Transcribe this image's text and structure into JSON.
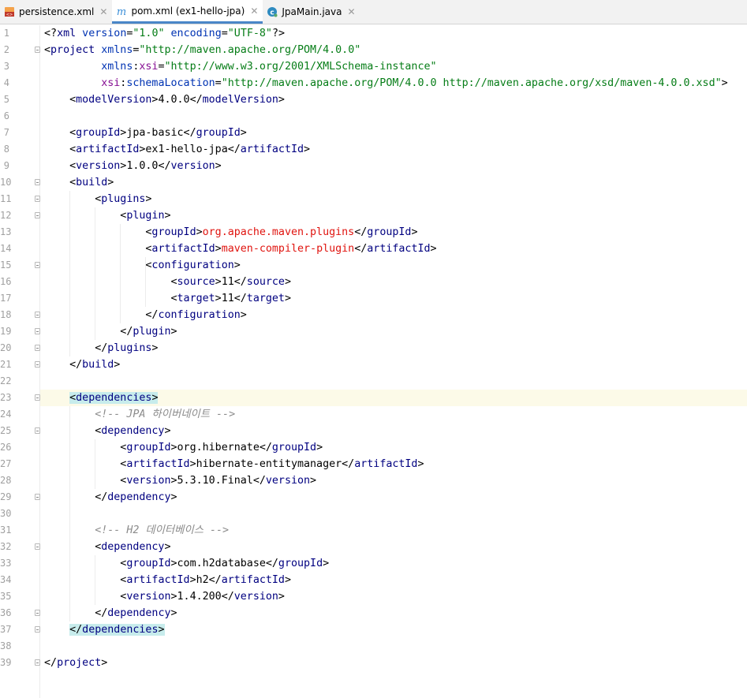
{
  "tabs": [
    {
      "label": "persistence.xml",
      "icon": "xml-file-icon",
      "active": false
    },
    {
      "label": "pom.xml (ex1-hello-jpa)",
      "icon": "maven-icon",
      "active": true
    },
    {
      "label": "JpaMain.java",
      "icon": "java-class-icon",
      "active": false
    }
  ],
  "editor": {
    "caret_line": 23,
    "lines": [
      [
        [
          "p",
          "<?"
        ],
        [
          "k",
          "xml "
        ],
        [
          "a",
          "version"
        ],
        [
          "p",
          "="
        ],
        [
          "s",
          "\"1.0\" "
        ],
        [
          "a",
          "encoding"
        ],
        [
          "p",
          "="
        ],
        [
          "s",
          "\"UTF-8\""
        ],
        [
          "p",
          "?>"
        ]
      ],
      [
        [
          "p",
          "<"
        ],
        [
          "k",
          "project "
        ],
        [
          "a",
          "xmlns"
        ],
        [
          "p",
          "="
        ],
        [
          "s",
          "\"http://maven.apache.org/POM/4.0.0\""
        ]
      ],
      [
        [
          "p",
          "         "
        ],
        [
          "a",
          "xmlns"
        ],
        [
          "p",
          ":"
        ],
        [
          "ns",
          "xsi"
        ],
        [
          "p",
          "="
        ],
        [
          "s",
          "\"http://www.w3.org/2001/XMLSchema-instance\""
        ]
      ],
      [
        [
          "p",
          "         "
        ],
        [
          "ns",
          "xsi"
        ],
        [
          "p",
          ":"
        ],
        [
          "a",
          "schemaLocation"
        ],
        [
          "p",
          "="
        ],
        [
          "s",
          "\"http://maven.apache.org/POM/4.0.0 http://maven.apache.org/xsd/maven-4.0.0.xsd\""
        ],
        [
          "p",
          ">"
        ]
      ],
      [
        [
          "p",
          "    <"
        ],
        [
          "k",
          "modelVersion"
        ],
        [
          "p",
          ">4.0.0</"
        ],
        [
          "k",
          "modelVersion"
        ],
        [
          "p",
          ">"
        ]
      ],
      [],
      [
        [
          "p",
          "    <"
        ],
        [
          "k",
          "groupId"
        ],
        [
          "p",
          ">jpa-basic</"
        ],
        [
          "k",
          "groupId"
        ],
        [
          "p",
          ">"
        ]
      ],
      [
        [
          "p",
          "    <"
        ],
        [
          "k",
          "artifactId"
        ],
        [
          "p",
          ">ex1-hello-jpa</"
        ],
        [
          "k",
          "artifactId"
        ],
        [
          "p",
          ">"
        ]
      ],
      [
        [
          "p",
          "    <"
        ],
        [
          "k",
          "version"
        ],
        [
          "p",
          ">1.0.0</"
        ],
        [
          "k",
          "version"
        ],
        [
          "p",
          ">"
        ]
      ],
      [
        [
          "p",
          "    <"
        ],
        [
          "k",
          "build"
        ],
        [
          "p",
          ">"
        ]
      ],
      [
        [
          "p",
          "        <"
        ],
        [
          "k",
          "plugins"
        ],
        [
          "p",
          ">"
        ]
      ],
      [
        [
          "p",
          "            <"
        ],
        [
          "k",
          "plugin"
        ],
        [
          "p",
          ">"
        ]
      ],
      [
        [
          "p",
          "                <"
        ],
        [
          "k",
          "groupId"
        ],
        [
          "p",
          ">"
        ],
        [
          "v",
          "org.apache.maven.plugins"
        ],
        [
          "p",
          "</"
        ],
        [
          "k",
          "groupId"
        ],
        [
          "p",
          ">"
        ]
      ],
      [
        [
          "p",
          "                <"
        ],
        [
          "k",
          "artifactId"
        ],
        [
          "p",
          ">"
        ],
        [
          "v",
          "maven-compiler-plugin"
        ],
        [
          "p",
          "</"
        ],
        [
          "k",
          "artifactId"
        ],
        [
          "p",
          ">"
        ]
      ],
      [
        [
          "p",
          "                <"
        ],
        [
          "k",
          "configuration"
        ],
        [
          "p",
          ">"
        ]
      ],
      [
        [
          "p",
          "                    <"
        ],
        [
          "k",
          "source"
        ],
        [
          "p",
          ">11</"
        ],
        [
          "k",
          "source"
        ],
        [
          "p",
          ">"
        ]
      ],
      [
        [
          "p",
          "                    <"
        ],
        [
          "k",
          "target"
        ],
        [
          "p",
          ">11</"
        ],
        [
          "k",
          "target"
        ],
        [
          "p",
          ">"
        ]
      ],
      [
        [
          "p",
          "                </"
        ],
        [
          "k",
          "configuration"
        ],
        [
          "p",
          ">"
        ]
      ],
      [
        [
          "p",
          "            </"
        ],
        [
          "k",
          "plugin"
        ],
        [
          "p",
          ">"
        ]
      ],
      [
        [
          "p",
          "        </"
        ],
        [
          "k",
          "plugins"
        ],
        [
          "p",
          ">"
        ]
      ],
      [
        [
          "p",
          "    </"
        ],
        [
          "k",
          "build"
        ],
        [
          "p",
          ">"
        ]
      ],
      [],
      [
        [
          "p",
          "    "
        ],
        [
          "hl",
          "<"
        ],
        [
          "hlk",
          "dependencies"
        ],
        [
          "hl",
          ">"
        ]
      ],
      [
        [
          "p",
          "        "
        ],
        [
          "c",
          "<!-- JPA 하이버네이트 -->"
        ]
      ],
      [
        [
          "p",
          "        <"
        ],
        [
          "k",
          "dependency"
        ],
        [
          "p",
          ">"
        ]
      ],
      [
        [
          "p",
          "            <"
        ],
        [
          "k",
          "groupId"
        ],
        [
          "p",
          ">org.hibernate</"
        ],
        [
          "k",
          "groupId"
        ],
        [
          "p",
          ">"
        ]
      ],
      [
        [
          "p",
          "            <"
        ],
        [
          "k",
          "artifactId"
        ],
        [
          "p",
          ">hibernate-entitymanager</"
        ],
        [
          "k",
          "artifactId"
        ],
        [
          "p",
          ">"
        ]
      ],
      [
        [
          "p",
          "            <"
        ],
        [
          "k",
          "version"
        ],
        [
          "p",
          ">5.3.10.Final</"
        ],
        [
          "k",
          "version"
        ],
        [
          "p",
          ">"
        ]
      ],
      [
        [
          "p",
          "        </"
        ],
        [
          "k",
          "dependency"
        ],
        [
          "p",
          ">"
        ]
      ],
      [],
      [
        [
          "p",
          "        "
        ],
        [
          "c",
          "<!-- H2 데이터베이스 -->"
        ]
      ],
      [
        [
          "p",
          "        <"
        ],
        [
          "k",
          "dependency"
        ],
        [
          "p",
          ">"
        ]
      ],
      [
        [
          "p",
          "            <"
        ],
        [
          "k",
          "groupId"
        ],
        [
          "p",
          ">com.h2database</"
        ],
        [
          "k",
          "groupId"
        ],
        [
          "p",
          ">"
        ]
      ],
      [
        [
          "p",
          "            <"
        ],
        [
          "k",
          "artifactId"
        ],
        [
          "p",
          ">h2</"
        ],
        [
          "k",
          "artifactId"
        ],
        [
          "p",
          ">"
        ]
      ],
      [
        [
          "p",
          "            <"
        ],
        [
          "k",
          "version"
        ],
        [
          "p",
          ">1.4.200</"
        ],
        [
          "k",
          "version"
        ],
        [
          "p",
          ">"
        ]
      ],
      [
        [
          "p",
          "        </"
        ],
        [
          "k",
          "dependency"
        ],
        [
          "p",
          ">"
        ]
      ],
      [
        [
          "p",
          "    "
        ],
        [
          "hl",
          "</"
        ],
        [
          "hlk",
          "dependencies"
        ],
        [
          "hl",
          ">"
        ]
      ],
      [],
      [
        [
          "p",
          "</"
        ],
        [
          "k",
          "project"
        ],
        [
          "p",
          ">"
        ]
      ]
    ],
    "fold_lines": [
      2,
      10,
      11,
      12,
      15,
      18,
      19,
      20,
      21,
      23,
      25,
      29,
      32,
      36,
      37,
      39
    ]
  }
}
